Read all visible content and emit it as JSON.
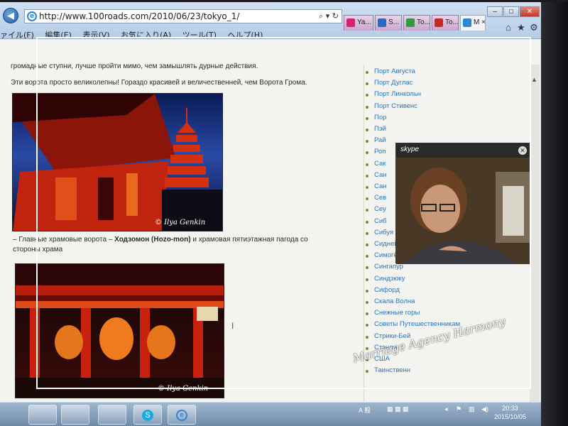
{
  "browser": {
    "url": "http://www.100roads.com/2010/06/23/tokyo_1/",
    "tabs": [
      {
        "label": "Ya...",
        "color": "#d6216f"
      },
      {
        "label": "S...",
        "color": "#2a6ab8"
      },
      {
        "label": "To...",
        "color": "#2d9c3c"
      },
      {
        "label": "To...",
        "color": "#c02a2a"
      },
      {
        "label": "М ×",
        "color": "#2a86d6"
      }
    ],
    "menu": [
      "ァイル(F)",
      "編集(E)",
      "表示(V)",
      "お気に入り(A)",
      "ツール(T)",
      "ヘルプ(H)"
    ],
    "window_controls": {
      "minimize": "–",
      "maximize": "□",
      "close": "✕"
    }
  },
  "article": {
    "para1": "громадные ступни, лучше пройти мимо, чем замышлять дурные действия.",
    "para2": "Эти ворота просто великолепны! Гораздо красивей и величественней, чем Ворота Грома.",
    "caption_pre": "– Главные храмовые ворота – ",
    "caption_bold": "Ходзомон (Hozo-mon)",
    "caption_post": " и храмовая пятиэтажная пагода со",
    "caption_line2": "стороны храма",
    "photo_credit": "© Ilya Genkin",
    "photo2_credit": "© Ilya Genkin"
  },
  "sidebar": {
    "items": [
      "Порт Августа",
      "Порт Дуглас",
      "Порт Линкольн",
      "Порт Стивенс",
      "Пор",
      "Пэй",
      "Рай",
      "Роп",
      "Сак",
      "Сан",
      "Сан",
      "Сев",
      "Сеу",
      "Сиб",
      "Сибуя",
      "Сидней",
      "Симогё-ку",
      "Сингапур",
      "Синдзюку",
      "Сифорд",
      "Скала Волна",
      "Снежные горы",
      "Советы Путешественникам",
      "Стрики-Бей",
      "Стэнли",
      "США",
      "Таинственн"
    ]
  },
  "skype": {
    "title": "skype"
  },
  "taskbar": {
    "clock_time": "20:33",
    "clock_date": "2015/10/05",
    "ime": "A 般"
  },
  "watermark": "Marriage Agency Harmony",
  "colors": {
    "link": "#2e74b8",
    "bullet": "#5d9a2c",
    "accent": "#c8102e"
  }
}
